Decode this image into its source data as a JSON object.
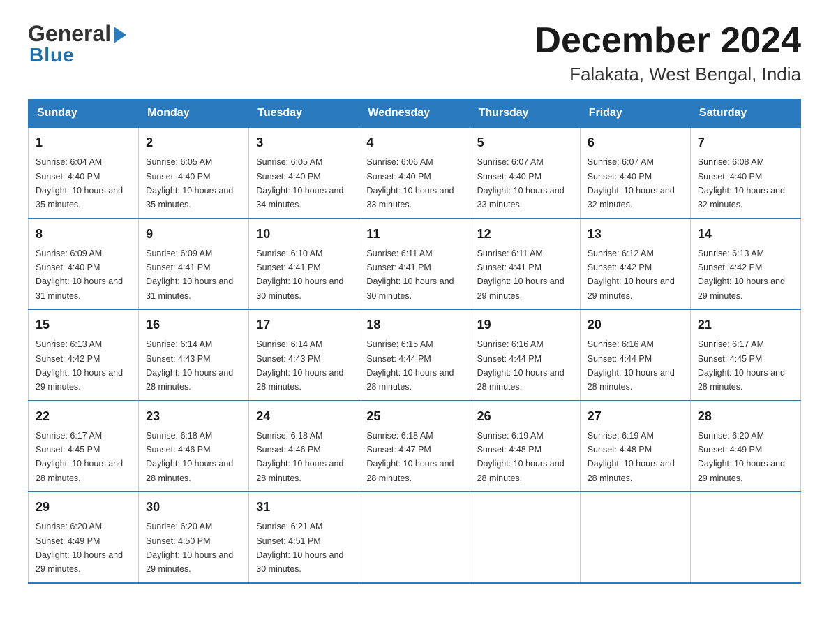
{
  "logo": {
    "general_text": "General",
    "blue_text": "Blue",
    "triangle_symbol": "▶"
  },
  "header": {
    "month_year": "December 2024",
    "location": "Falakata, West Bengal, India"
  },
  "columns": [
    "Sunday",
    "Monday",
    "Tuesday",
    "Wednesday",
    "Thursday",
    "Friday",
    "Saturday"
  ],
  "weeks": [
    [
      {
        "day": "1",
        "sunrise": "Sunrise: 6:04 AM",
        "sunset": "Sunset: 4:40 PM",
        "daylight": "Daylight: 10 hours and 35 minutes."
      },
      {
        "day": "2",
        "sunrise": "Sunrise: 6:05 AM",
        "sunset": "Sunset: 4:40 PM",
        "daylight": "Daylight: 10 hours and 35 minutes."
      },
      {
        "day": "3",
        "sunrise": "Sunrise: 6:05 AM",
        "sunset": "Sunset: 4:40 PM",
        "daylight": "Daylight: 10 hours and 34 minutes."
      },
      {
        "day": "4",
        "sunrise": "Sunrise: 6:06 AM",
        "sunset": "Sunset: 4:40 PM",
        "daylight": "Daylight: 10 hours and 33 minutes."
      },
      {
        "day": "5",
        "sunrise": "Sunrise: 6:07 AM",
        "sunset": "Sunset: 4:40 PM",
        "daylight": "Daylight: 10 hours and 33 minutes."
      },
      {
        "day": "6",
        "sunrise": "Sunrise: 6:07 AM",
        "sunset": "Sunset: 4:40 PM",
        "daylight": "Daylight: 10 hours and 32 minutes."
      },
      {
        "day": "7",
        "sunrise": "Sunrise: 6:08 AM",
        "sunset": "Sunset: 4:40 PM",
        "daylight": "Daylight: 10 hours and 32 minutes."
      }
    ],
    [
      {
        "day": "8",
        "sunrise": "Sunrise: 6:09 AM",
        "sunset": "Sunset: 4:40 PM",
        "daylight": "Daylight: 10 hours and 31 minutes."
      },
      {
        "day": "9",
        "sunrise": "Sunrise: 6:09 AM",
        "sunset": "Sunset: 4:41 PM",
        "daylight": "Daylight: 10 hours and 31 minutes."
      },
      {
        "day": "10",
        "sunrise": "Sunrise: 6:10 AM",
        "sunset": "Sunset: 4:41 PM",
        "daylight": "Daylight: 10 hours and 30 minutes."
      },
      {
        "day": "11",
        "sunrise": "Sunrise: 6:11 AM",
        "sunset": "Sunset: 4:41 PM",
        "daylight": "Daylight: 10 hours and 30 minutes."
      },
      {
        "day": "12",
        "sunrise": "Sunrise: 6:11 AM",
        "sunset": "Sunset: 4:41 PM",
        "daylight": "Daylight: 10 hours and 29 minutes."
      },
      {
        "day": "13",
        "sunrise": "Sunrise: 6:12 AM",
        "sunset": "Sunset: 4:42 PM",
        "daylight": "Daylight: 10 hours and 29 minutes."
      },
      {
        "day": "14",
        "sunrise": "Sunrise: 6:13 AM",
        "sunset": "Sunset: 4:42 PM",
        "daylight": "Daylight: 10 hours and 29 minutes."
      }
    ],
    [
      {
        "day": "15",
        "sunrise": "Sunrise: 6:13 AM",
        "sunset": "Sunset: 4:42 PM",
        "daylight": "Daylight: 10 hours and 29 minutes."
      },
      {
        "day": "16",
        "sunrise": "Sunrise: 6:14 AM",
        "sunset": "Sunset: 4:43 PM",
        "daylight": "Daylight: 10 hours and 28 minutes."
      },
      {
        "day": "17",
        "sunrise": "Sunrise: 6:14 AM",
        "sunset": "Sunset: 4:43 PM",
        "daylight": "Daylight: 10 hours and 28 minutes."
      },
      {
        "day": "18",
        "sunrise": "Sunrise: 6:15 AM",
        "sunset": "Sunset: 4:44 PM",
        "daylight": "Daylight: 10 hours and 28 minutes."
      },
      {
        "day": "19",
        "sunrise": "Sunrise: 6:16 AM",
        "sunset": "Sunset: 4:44 PM",
        "daylight": "Daylight: 10 hours and 28 minutes."
      },
      {
        "day": "20",
        "sunrise": "Sunrise: 6:16 AM",
        "sunset": "Sunset: 4:44 PM",
        "daylight": "Daylight: 10 hours and 28 minutes."
      },
      {
        "day": "21",
        "sunrise": "Sunrise: 6:17 AM",
        "sunset": "Sunset: 4:45 PM",
        "daylight": "Daylight: 10 hours and 28 minutes."
      }
    ],
    [
      {
        "day": "22",
        "sunrise": "Sunrise: 6:17 AM",
        "sunset": "Sunset: 4:45 PM",
        "daylight": "Daylight: 10 hours and 28 minutes."
      },
      {
        "day": "23",
        "sunrise": "Sunrise: 6:18 AM",
        "sunset": "Sunset: 4:46 PM",
        "daylight": "Daylight: 10 hours and 28 minutes."
      },
      {
        "day": "24",
        "sunrise": "Sunrise: 6:18 AM",
        "sunset": "Sunset: 4:46 PM",
        "daylight": "Daylight: 10 hours and 28 minutes."
      },
      {
        "day": "25",
        "sunrise": "Sunrise: 6:18 AM",
        "sunset": "Sunset: 4:47 PM",
        "daylight": "Daylight: 10 hours and 28 minutes."
      },
      {
        "day": "26",
        "sunrise": "Sunrise: 6:19 AM",
        "sunset": "Sunset: 4:48 PM",
        "daylight": "Daylight: 10 hours and 28 minutes."
      },
      {
        "day": "27",
        "sunrise": "Sunrise: 6:19 AM",
        "sunset": "Sunset: 4:48 PM",
        "daylight": "Daylight: 10 hours and 28 minutes."
      },
      {
        "day": "28",
        "sunrise": "Sunrise: 6:20 AM",
        "sunset": "Sunset: 4:49 PM",
        "daylight": "Daylight: 10 hours and 29 minutes."
      }
    ],
    [
      {
        "day": "29",
        "sunrise": "Sunrise: 6:20 AM",
        "sunset": "Sunset: 4:49 PM",
        "daylight": "Daylight: 10 hours and 29 minutes."
      },
      {
        "day": "30",
        "sunrise": "Sunrise: 6:20 AM",
        "sunset": "Sunset: 4:50 PM",
        "daylight": "Daylight: 10 hours and 29 minutes."
      },
      {
        "day": "31",
        "sunrise": "Sunrise: 6:21 AM",
        "sunset": "Sunset: 4:51 PM",
        "daylight": "Daylight: 10 hours and 30 minutes."
      },
      null,
      null,
      null,
      null
    ]
  ]
}
